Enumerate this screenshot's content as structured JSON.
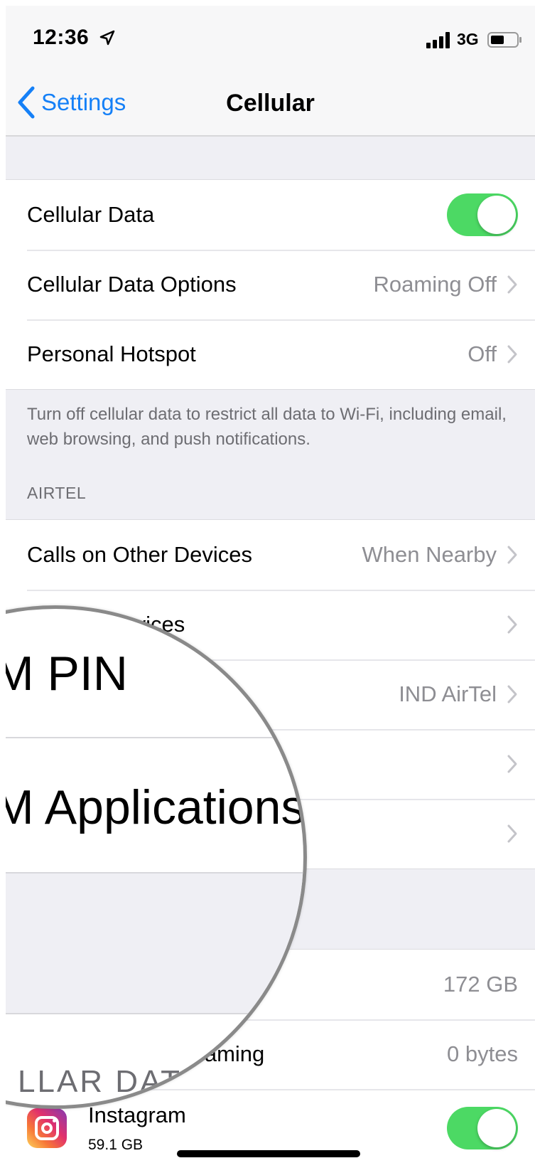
{
  "status_bar": {
    "time": "12:36",
    "network": "3G",
    "icons": [
      "location-arrow-icon",
      "signal-bars-icon",
      "battery-icon"
    ]
  },
  "nav": {
    "back_label": "Settings",
    "title": "Cellular"
  },
  "group1": {
    "cellular_data": {
      "label": "Cellular Data",
      "on": true
    },
    "data_options": {
      "label": "Cellular Data Options",
      "value": "Roaming Off"
    },
    "hotspot": {
      "label": "Personal Hotspot",
      "value": "Off"
    }
  },
  "footer_note": "Turn off cellular data to restrict all data to Wi-Fi, including email, web browsing, and push notifications.",
  "section_header": "AIRTEL",
  "group2": {
    "calls_other": {
      "label": "Calls on Other Devices",
      "value": "When Nearby"
    },
    "carrier_services": {
      "label": "Carrier Services"
    },
    "sim_pin": {
      "value": "IND AirTel"
    }
  },
  "magnifier": {
    "line1": "M PIN",
    "line2": "M Applications",
    "partial": "LLAR DAT"
  },
  "usage": {
    "current_period": {
      "value": "172 GB"
    },
    "roaming": {
      "label": "Current Period Roaming",
      "value": "0 bytes"
    }
  },
  "apps": [
    {
      "name": "Instagram",
      "size": "59.1 GB",
      "on": true
    }
  ],
  "colors": {
    "accent": "#1580f7",
    "toggle_on": "#4cd964",
    "background": "#efeff4"
  }
}
